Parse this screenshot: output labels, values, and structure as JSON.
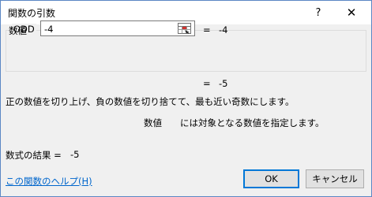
{
  "dialog": {
    "title": "関数の引数",
    "help_button": "?",
    "close_button": "✕"
  },
  "function": {
    "name": "ODD",
    "argument": {
      "label": "数値",
      "value": "-4",
      "eq": "=",
      "evaluated": "-4"
    },
    "result_eq": "=",
    "result": "-5",
    "description": "正の数値を切り上げ、負の数値を切り捨てて、最も近い奇数にします。",
    "arg_help_name": "数値",
    "arg_help_text": "には対象となる数値を指定します。"
  },
  "formula": {
    "label": "数式の結果 =",
    "value": "-5"
  },
  "footer": {
    "help_link": "この関数のヘルプ(H)",
    "ok": "OK",
    "cancel": "キャンセル"
  },
  "icons": {
    "ref_button": "range-select-icon"
  }
}
